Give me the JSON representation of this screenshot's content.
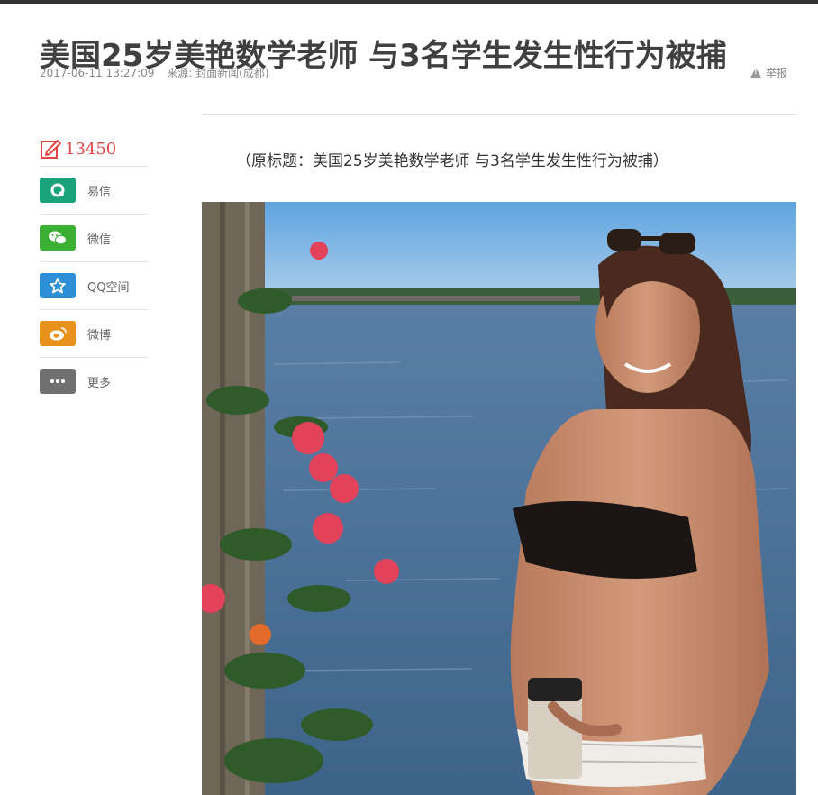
{
  "article": {
    "title": "美国25岁美艳数学老师 与3名学生发生性行为被捕",
    "date": "2017-06-11 13:27:09",
    "source": "来源: 封面新闻(成都)",
    "report_label": "举报",
    "subtitle": "（原标题：美国25岁美艳数学老师 与3名学生发生性行为被捕）"
  },
  "share": {
    "comment_count": "13450",
    "items": [
      {
        "label": "易信",
        "icon": "yixin-icon",
        "color": "#1aa37a"
      },
      {
        "label": "微信",
        "icon": "wechat-icon",
        "color": "#3cb034"
      },
      {
        "label": "QQ空间",
        "icon": "qzone-icon",
        "color": "#2d8fd5"
      },
      {
        "label": "微博",
        "icon": "weibo-icon",
        "color": "#e8921b"
      },
      {
        "label": "更多",
        "icon": "more-icon",
        "color": "#707070"
      }
    ]
  },
  "colors": {
    "accent": "#e24545",
    "title": "#404040",
    "meta": "#888888"
  }
}
